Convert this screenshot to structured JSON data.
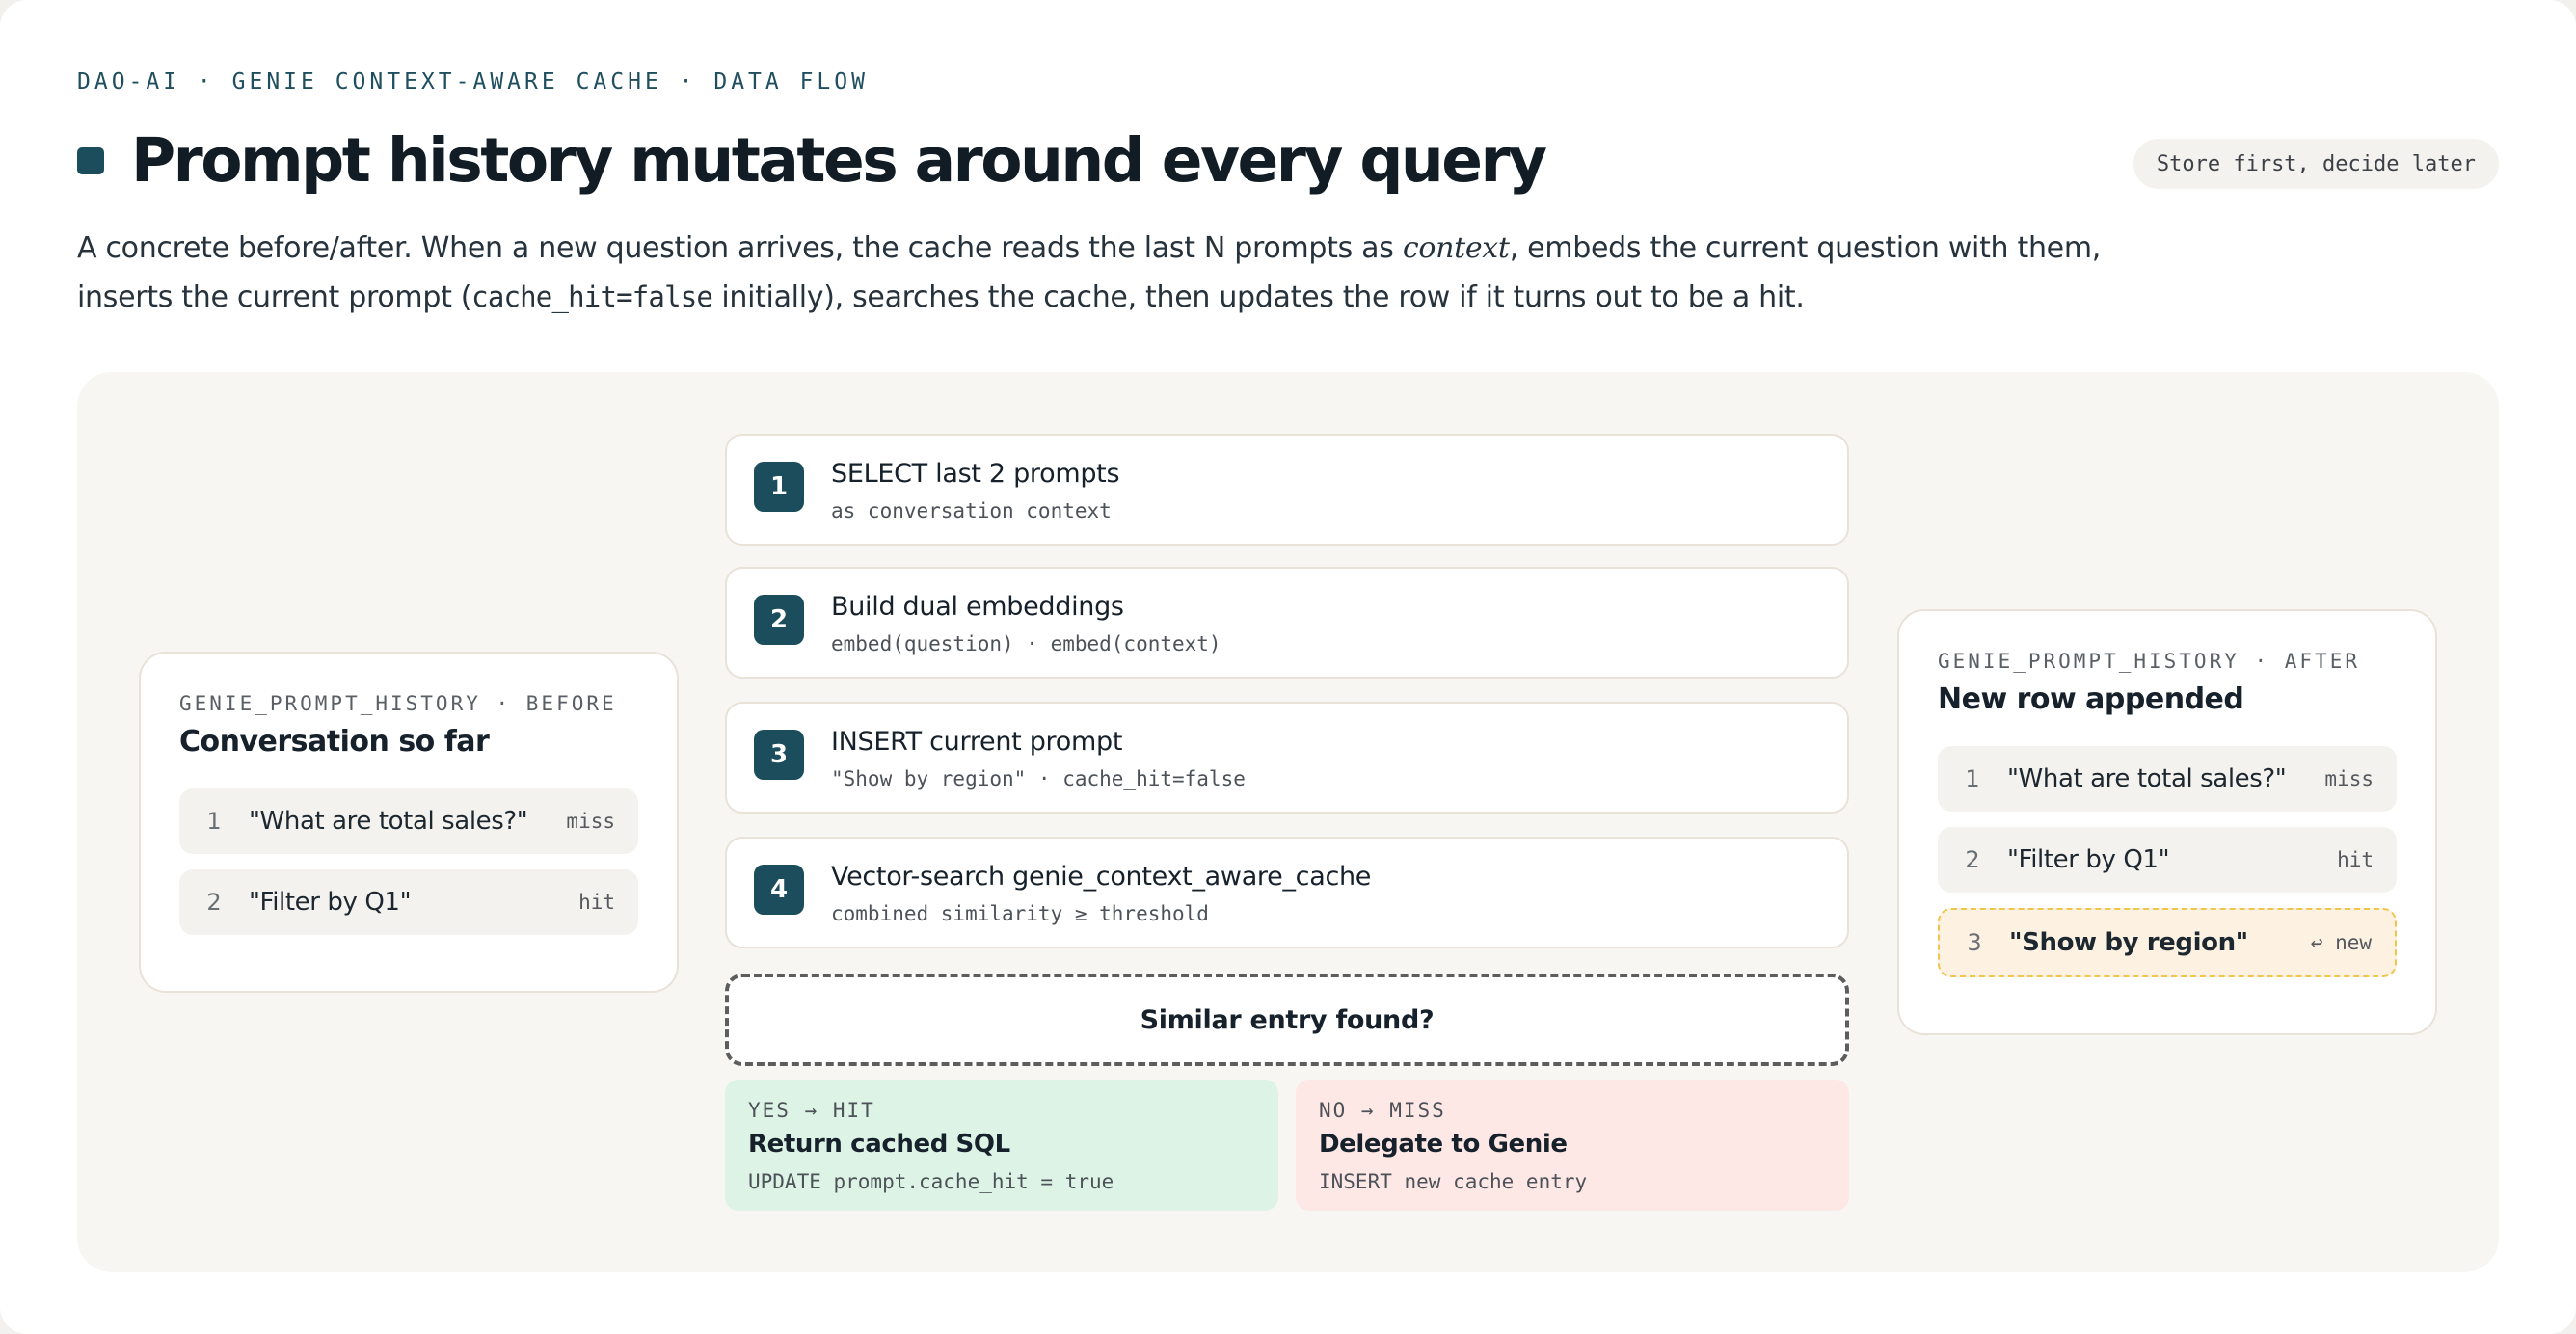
{
  "header": {
    "eyebrow": "DAO-AI · GENIE CONTEXT-AWARE CACHE · DATA FLOW",
    "title": "Prompt history mutates around every query",
    "pill": "Store first, decide later",
    "subtitle": {
      "part1": "A concrete before/after. When a new question arrives, the cache reads the last N prompts as ",
      "em": "context",
      "part2": ", embeds the current question with them, inserts the current prompt (",
      "code": "cache_hit=false",
      "part3": " initially), searches the cache, then updates the row if it turns out to be a hit."
    }
  },
  "before": {
    "eyebrow": "GENIE_PROMPT_HISTORY · BEFORE",
    "title": "Conversation so far",
    "rows": [
      {
        "num": "1",
        "text": "\"What are total sales?\"",
        "tag": "miss"
      },
      {
        "num": "2",
        "text": "\"Filter by Q1\"",
        "tag": "hit"
      }
    ]
  },
  "steps": [
    {
      "num": "1",
      "title": "SELECT last 2 prompts",
      "sub": "as conversation context"
    },
    {
      "num": "2",
      "title": "Build dual embeddings",
      "sub": "embed(question) · embed(context)"
    },
    {
      "num": "3",
      "title": "INSERT current prompt",
      "sub": "\"Show by region\" · cache_hit=false"
    },
    {
      "num": "4",
      "title": "Vector-search genie_context_aware_cache",
      "sub": "combined similarity ≥ threshold"
    }
  ],
  "decision": {
    "label": "Similar entry found?"
  },
  "outcomes": {
    "hit": {
      "label": "YES → HIT",
      "title": "Return cached SQL",
      "sub": "UPDATE prompt.cache_hit = true",
      "color": "#dcf3e5"
    },
    "miss": {
      "label": "NO → MISS",
      "title": "Delegate to Genie",
      "sub": "INSERT new cache entry",
      "color": "#fde8e6"
    }
  },
  "after": {
    "eyebrow": "GENIE_PROMPT_HISTORY · AFTER",
    "title": "New row appended",
    "rows": [
      {
        "num": "1",
        "text": "\"What are total sales?\"",
        "tag": "miss"
      },
      {
        "num": "2",
        "text": "\"Filter by Q1\"",
        "tag": "hit"
      },
      {
        "num": "3",
        "text": "\"Show by region\"",
        "tag": "↩ new"
      }
    ]
  },
  "colors": {
    "accent": "#1b4d5c",
    "new_row_bg": "#fdf1e1",
    "new_row_border": "#efc54c"
  }
}
